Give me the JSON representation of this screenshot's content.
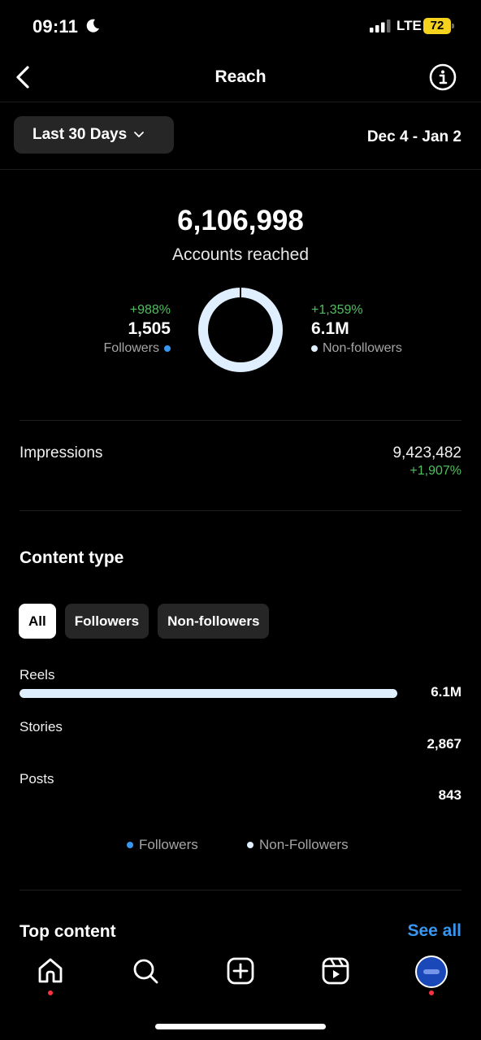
{
  "status_bar": {
    "time": "09:11",
    "network": "LTE",
    "battery": "72"
  },
  "header": {
    "title": "Reach",
    "back_icon": "chevron-left-icon",
    "info_icon": "info-circle-icon"
  },
  "filter": {
    "range_label": "Last 30 Days",
    "date_range": "Dec 4 - Jan 2"
  },
  "reach": {
    "total": "6,106,998",
    "label": "Accounts reached",
    "followers": {
      "change": "+988%",
      "value": "1,505",
      "label": "Followers",
      "share": 0.0002
    },
    "non_followers": {
      "change": "+1,359%",
      "value": "6.1M",
      "label": "Non-followers",
      "share": 0.9998
    }
  },
  "impressions": {
    "label": "Impressions",
    "value": "9,423,482",
    "change": "+1,907%"
  },
  "content_type": {
    "title": "Content type",
    "tabs": [
      {
        "label": "All",
        "active": true
      },
      {
        "label": "Followers",
        "active": false
      },
      {
        "label": "Non-followers",
        "active": false
      }
    ],
    "rows": [
      {
        "label": "Reels",
        "value": "6.1M",
        "fraction": 1.0
      },
      {
        "label": "Stories",
        "value": "2,867",
        "fraction": 0.0005
      },
      {
        "label": "Posts",
        "value": "843",
        "fraction": 0.0001
      }
    ],
    "legend": {
      "followers": "Followers",
      "non_followers": "Non-Followers"
    }
  },
  "top_content": {
    "title": "Top content",
    "see_all": "See all"
  },
  "colors": {
    "accent_blue": "#3797f0",
    "positive_green": "#4fbf5f",
    "non_follower_bar": "#dfefff",
    "battery_yellow": "#f4d21e"
  },
  "nav": {
    "items": [
      "home-icon",
      "search-icon",
      "create-icon",
      "reels-icon",
      "profile-avatar"
    ]
  }
}
